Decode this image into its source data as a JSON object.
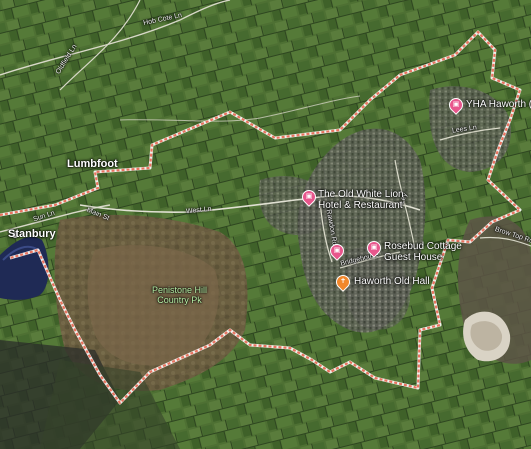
{
  "map": {
    "places": {
      "stanbury": "Stanbury",
      "lumbfoot": "Lumbfoot"
    },
    "roads": {
      "hob_cote_ln": "Hob Cote Ln",
      "oldfield_ln": "Oldfield Ln",
      "sun_ln": "Sun Ln",
      "main_st": "Main St",
      "west_ln": "West Ln",
      "rawdon_rd": "Rawdon Rd",
      "bridgehouse_ln": "Bridgehouse",
      "ley_ln": "Ley",
      "lees_ln": "Lees Ln",
      "brow_top_rd": "Brow Top Rd"
    },
    "pois": {
      "old_white_lion_l1": "The Old White Lion",
      "old_white_lion_l2": "Hotel & Restaurant",
      "rosebud_l1": "Rosebud Cottage",
      "rosebud_l2": "Guest House",
      "haworth_old_hall": "Haworth Old Hall",
      "yha_haworth": "YHA Haworth (R"
    },
    "parks": {
      "penistone_l1": "Penistone Hill",
      "penistone_l2": "Country Pk"
    },
    "icons": {
      "hotel": "bed-icon",
      "food": "fork-knife-icon"
    },
    "colors": {
      "hotel_pin": "#e8568c",
      "food_pin": "#f1872b",
      "boundary": "#e8735f"
    }
  }
}
